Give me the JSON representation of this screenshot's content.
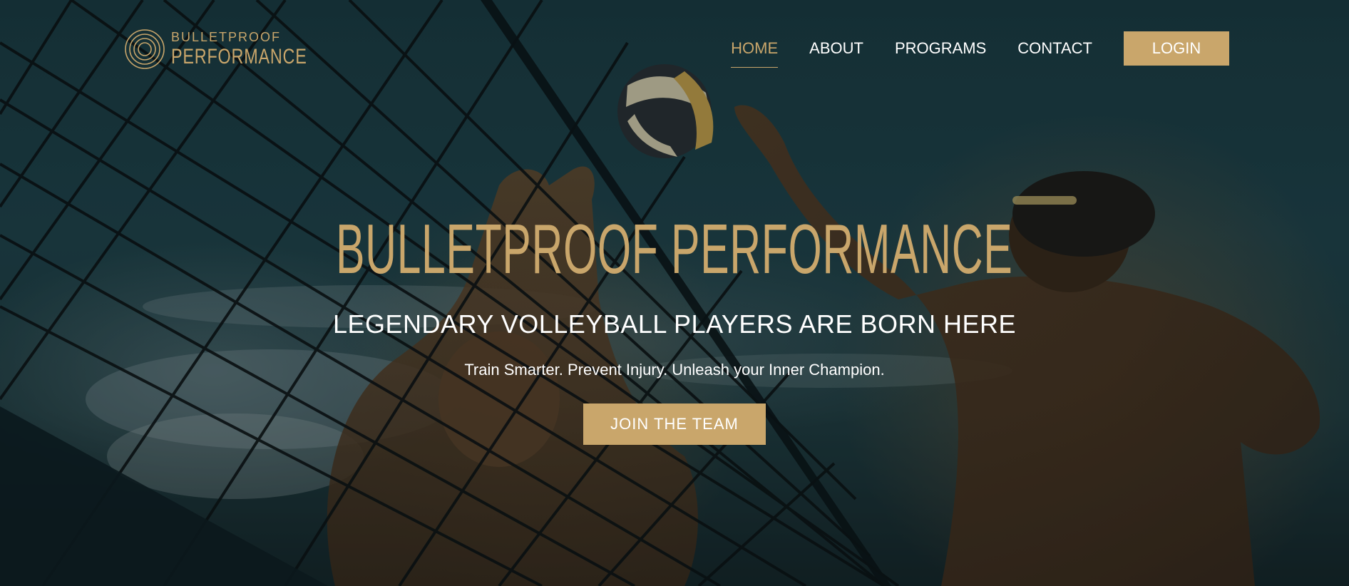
{
  "brand": {
    "logo_top": "BULLETPROOF",
    "logo_bottom": "PERFORMANCE",
    "logo_icon": "concentric-rings-icon",
    "accent_color": "#c9a66b"
  },
  "nav": {
    "items": [
      {
        "label": "HOME",
        "active": true
      },
      {
        "label": "ABOUT",
        "active": false
      },
      {
        "label": "PROGRAMS",
        "active": false
      },
      {
        "label": "CONTACT",
        "active": false
      }
    ],
    "login_label": "LOGIN"
  },
  "hero": {
    "title": "BULLETPROOF PERFORMANCE",
    "subtitle": "LEGENDARY VOLLEYBALL PLAYERS ARE BORN HERE",
    "tagline": "Train Smarter. Prevent Injury. Unleash your Inner Champion.",
    "cta_label": "JOIN THE TEAM"
  }
}
